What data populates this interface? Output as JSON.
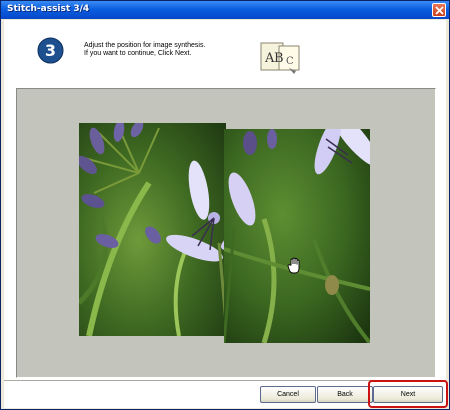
{
  "window": {
    "title": "Stitch-assist 3/4"
  },
  "step": {
    "number": "3",
    "instruction_line1": "Adjust the position for image synthesis.",
    "instruction_line2": "If you want to continue, Click Next.",
    "icon": "abc-text-icon"
  },
  "canvas": {
    "cursor_icon": "hand-cursor-icon"
  },
  "buttons": {
    "cancel": "Cancel",
    "back": "Back",
    "next": "Next"
  },
  "colors": {
    "titlebar": "#0b5fe0",
    "step_badge": "#1e4f8f",
    "highlight": "#cc1111"
  }
}
